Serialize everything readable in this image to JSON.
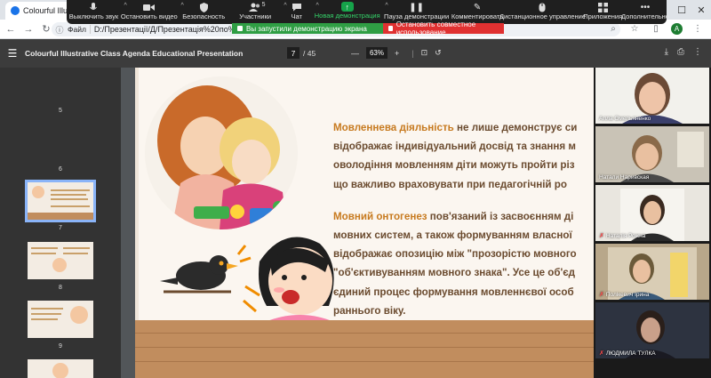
{
  "browser": {
    "tab_title": "Colourful Illustrativ",
    "omnibox_chip": "Файл",
    "url": "D:/Презентації/Д/Презентація%20по%20курсо",
    "window_controls": [
      "–",
      "☐",
      "✕"
    ]
  },
  "zoom_toolbar": {
    "items": [
      {
        "label": "Выключить звук",
        "icon": "microphone-icon"
      },
      {
        "label": "Остановить видео",
        "icon": "video-camera-icon"
      },
      {
        "label": "Безопасность",
        "icon": "shield-icon"
      },
      {
        "label": "Участники",
        "icon": "people-icon",
        "count": "5"
      },
      {
        "label": "Чат",
        "icon": "chat-icon"
      },
      {
        "label": "Новая демонстрация",
        "icon": "share-screen-icon"
      },
      {
        "label": "Пауза демонстрации",
        "icon": "pause-icon"
      },
      {
        "label": "Комментировать",
        "icon": "pencil-icon"
      },
      {
        "label": "Дистанционное управление",
        "icon": "mouse-icon"
      },
      {
        "label": "Приложения",
        "icon": "apps-icon"
      },
      {
        "label": "Дополнительно",
        "icon": "more-icon"
      }
    ]
  },
  "share_notice": {
    "sharing_text": "Вы запустили демонстрацию экрана",
    "stop_text": "Остановить совместное использование"
  },
  "pdf_toolbar": {
    "title": "Colourful Illustrative Class Agenda Educational Presentation",
    "current_page": "7",
    "total_pages": "/ 45",
    "zoom": "63%",
    "zoom_minus": "—",
    "zoom_plus": "+"
  },
  "thumbnails": {
    "page_numbers": [
      "5",
      "6",
      "7",
      "8",
      "9"
    ]
  },
  "slide": {
    "para1_lines": [
      {
        "hl": "Мовленнева діяльність",
        "text": " не лише демонструє си"
      },
      {
        "hl": "",
        "text": "відображає індивідуальний досвід та знання м"
      },
      {
        "hl": "",
        "text": "оволодіння мовленням діти можуть пройти різ"
      },
      {
        "hl": "",
        "text": "що важливо враховувати при педагогічній ро"
      }
    ],
    "para2_lines": [
      {
        "hl": "Мовний онтогенез",
        "text": " пов'язаний із засвоєнням ді"
      },
      {
        "hl": "",
        "text": "мовних систем, а також формуванням власної"
      },
      {
        "hl": "",
        "text": "відображає опозицію між \"прозорістю мовного"
      },
      {
        "hl": "",
        "text": "\"об'єктивуванням мовного знака\". Усе це об'єд"
      },
      {
        "hl": "",
        "text": "єдиний процес формування мовленнєвої особ"
      },
      {
        "hl": "",
        "text": "раннього віку."
      }
    ]
  },
  "participants": [
    {
      "name": "Алла Омельяненко",
      "muted": false,
      "bg": "#f2f1ec"
    },
    {
      "name": "Натали Наривская",
      "muted": false,
      "bg": "#c9c3b6"
    },
    {
      "name": "Наталія Рожна",
      "muted": true,
      "bg": "#e9e6df"
    },
    {
      "name": "Полікевич Ірина",
      "muted": true,
      "bg": "#b8a78a"
    },
    {
      "name": "ЛЮДМИЛА ТУЛКА",
      "muted": true,
      "bg": "#2d3340"
    }
  ]
}
